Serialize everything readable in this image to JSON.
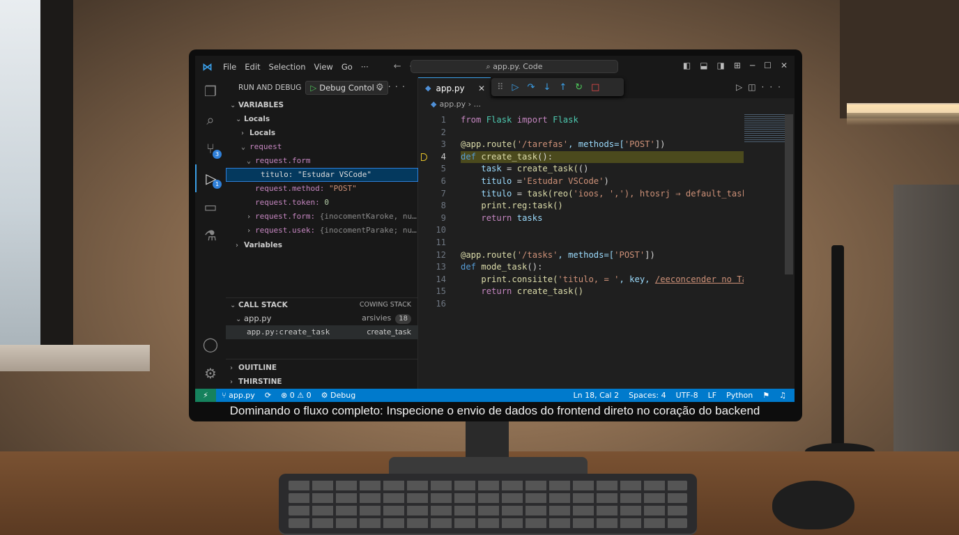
{
  "caption": "Dominando o fluxo completo: Inspecione o envio de dados do frontend direto no coração do backend",
  "titlebar": {
    "logo_icon": "vscode-logo",
    "menu": [
      "File",
      "Edit",
      "Selection",
      "View",
      "Go",
      "···"
    ],
    "search": "app.py. Code"
  },
  "activity_bar": {
    "items": [
      "explorer-icon",
      "search-icon",
      "source-control-icon",
      "run-debug-icon",
      "remote-explorer-icon",
      "testing-icon",
      "account-icon",
      "settings-gear-icon"
    ],
    "badges": {
      "source_control": "3",
      "run_debug": "1"
    }
  },
  "sidebar": {
    "header": "RUN AND DEBUG",
    "debug_config": "Debug Contol",
    "variables": {
      "title": "VARIABLES",
      "locals": "Locals",
      "locals_child": "Locals",
      "request": "request",
      "request_form": "request.form",
      "titulo_key": "titulo:",
      "titulo_val": "\"Estudar VSCode\"",
      "method_key": "request.method:",
      "method_val": "\"POST\"",
      "token_key": "request.token:",
      "token_val": "0",
      "form2_key": "request.form:",
      "form2_val": "{inocomentKaroke, nu…",
      "usek_key": "request.usek:",
      "usek_val": "{inocomentParake; nu…",
      "variables": "Variables"
    },
    "call_stack": {
      "title": "CALL STACK",
      "right": "COWING STACK",
      "thread": "app.py",
      "thread_status": "arsivies",
      "thread_count": "18",
      "frame": "app.py:create_task",
      "frame_right": "create_task"
    },
    "outline": "OUITLINE",
    "timeline": "THIRSTINE"
  },
  "editor": {
    "tab": "app.py",
    "breadcrumb_file": "app.py",
    "breadcrumb_rest": "› ...",
    "current_line": 4,
    "lines": [
      {
        "n": "1"
      },
      {
        "n": "2"
      },
      {
        "n": "3"
      },
      {
        "n": "4"
      },
      {
        "n": "5"
      },
      {
        "n": "6"
      },
      {
        "n": "7"
      },
      {
        "n": "8"
      },
      {
        "n": "9"
      },
      {
        "n": "10"
      },
      {
        "n": "11"
      },
      {
        "n": "12"
      },
      {
        "n": "13"
      },
      {
        "n": "14"
      },
      {
        "n": "15"
      },
      {
        "n": "16"
      }
    ],
    "code": {
      "l1_from": "from",
      "l1_mod": "Flask",
      "l1_import": "import",
      "l1_cls": "Flask",
      "l3_deco": "@app.route(",
      "l3_str": "'/tarefas'",
      "l3_mid": ", methods=[",
      "l3_post": "'POST'",
      "l3_end": "])",
      "l4_def": "def",
      "l4_fn": "create_task",
      "l4_end": "():",
      "l5_var": "task",
      "l5_eq": " = ",
      "l5_fn": "create_task(",
      "l5_end": "()",
      "l6_var": "titulo",
      "l6_eq": " =",
      "l6_str": "'Estudar VSCode'",
      "l6_end": ")",
      "l7_var": "titulo",
      "l7_eq": " = ",
      "l7_fn": "task(",
      "l7_fn2": "reo(",
      "l7_str": "'ioos, ',')",
      "l7_rest": ", htosrj ⇒ default_task",
      "l8_fn": "print.reg:task()",
      "l9_ret": "return",
      "l9_var": "tasks",
      "l12_deco": "@app.route(",
      "l12_str": "'/tasks'",
      "l12_mid": ", methods=[",
      "l12_post": "'POST'",
      "l12_end": "])",
      "l13_def": "def",
      "l13_fn": "mode_task",
      "l13_end": "():",
      "l14_fn": "print.consiite(",
      "l14_str": "'titulo, = '",
      "l14_mid": ", key, ",
      "l14_ul": "/eeconcender no Tas",
      "l15_ret": "return",
      "l15_fn": "create_task()"
    }
  },
  "statusbar": {
    "branch": "app.py",
    "errors": "0",
    "warnings": "0",
    "mode": "Debug",
    "position": "Ln 18, Cal 2",
    "spaces": "Spaces: 4",
    "encoding": "UTF-8",
    "eol": "LF",
    "language": "Python",
    "colors": {
      "bar": "#007acc",
      "remote": "#16825d"
    }
  }
}
